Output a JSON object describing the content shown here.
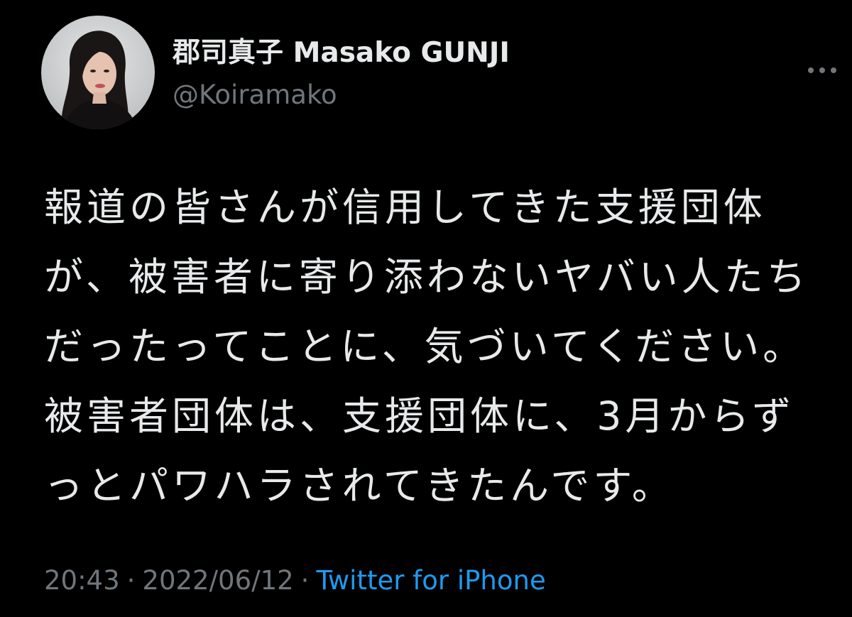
{
  "author": {
    "display_name": "郡司真子 Masako GUNJI",
    "handle": "@Koiramako",
    "avatar_icon": "profile-photo"
  },
  "tweet": {
    "lines": [
      "報道の皆さんが信用してきた支援団体",
      "が、被害者に寄り添わないヤバい人たち",
      "だったってことに、気づいてください。",
      "被害者団体は、支援団体に、3月からず",
      "っとパワハラされてきたんです。"
    ]
  },
  "meta": {
    "time": "20:43",
    "date": "2022/06/12",
    "separator": "·",
    "source": "Twitter for iPhone"
  },
  "icons": {
    "more": "more-options-icon"
  },
  "colors": {
    "background": "#000000",
    "text": "#e7e9ea",
    "secondary_text": "#71767b",
    "link": "#1d9bf0"
  }
}
